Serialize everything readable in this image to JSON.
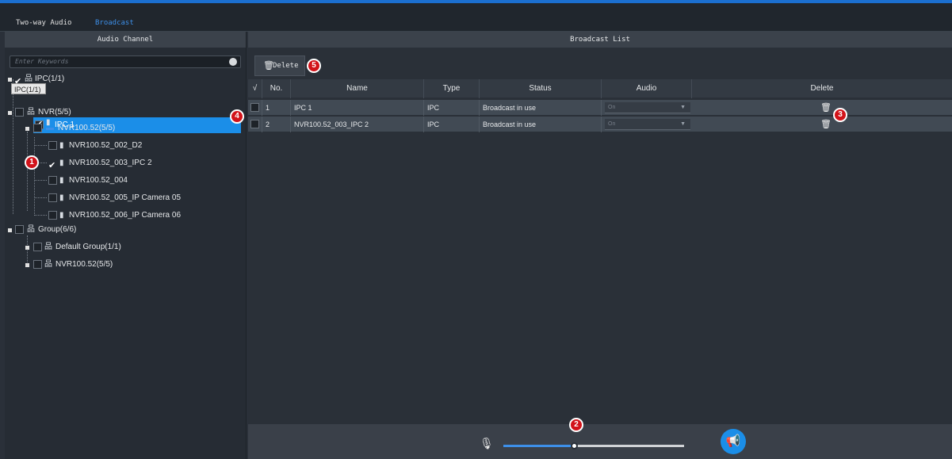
{
  "tabs": [
    {
      "label": "Two-way Audio",
      "active": false
    },
    {
      "label": "Broadcast",
      "active": true
    }
  ],
  "left_panel": {
    "title": "Audio Channel",
    "search_placeholder": "Enter Keywords",
    "tooltip": "IPC(1/1)",
    "tree": {
      "ipc_group": "IPC(1/1)",
      "ipc1": "IPC 1",
      "nvr_group": "NVR(5/5)",
      "nvr_device": "NVR100.52(5/5)",
      "cam1": "NVR100.52_002_D2",
      "cam2": "NVR100.52_003_IPC 2",
      "cam3": "NVR100.52_004",
      "cam4": "NVR100.52_005_IP Camera 05",
      "cam5": "NVR100.52_006_IP Camera 06",
      "group_group": "Group(6/6)",
      "default_group": "Default Group(1/1)",
      "group_nvr": "NVR100.52(5/5)"
    }
  },
  "right_panel": {
    "title": "Broadcast List",
    "delete_button": "Delete",
    "columns": [
      "√",
      "No.",
      "Name",
      "Type",
      "Status",
      "Audio",
      "Delete"
    ],
    "rows": [
      {
        "no": "1",
        "name": "IPC 1",
        "type": "IPC",
        "status": "Broadcast in use",
        "audio": "On"
      },
      {
        "no": "2",
        "name": "NVR100.52_003_IPC 2",
        "type": "IPC",
        "status": "Broadcast in use",
        "audio": "On"
      }
    ]
  },
  "footer": {
    "volume_level": 0.39
  },
  "callouts": [
    "1",
    "2",
    "3",
    "4",
    "5"
  ],
  "colors": {
    "accent": "#1b8ee8",
    "callout": "#d2131a",
    "topbar": "#1b6fd0"
  },
  "icons": [
    "search-icon",
    "trash-icon",
    "microphone-icon",
    "megaphone-icon",
    "network-tree-icon",
    "camera-icon",
    "nvr-icon"
  ]
}
